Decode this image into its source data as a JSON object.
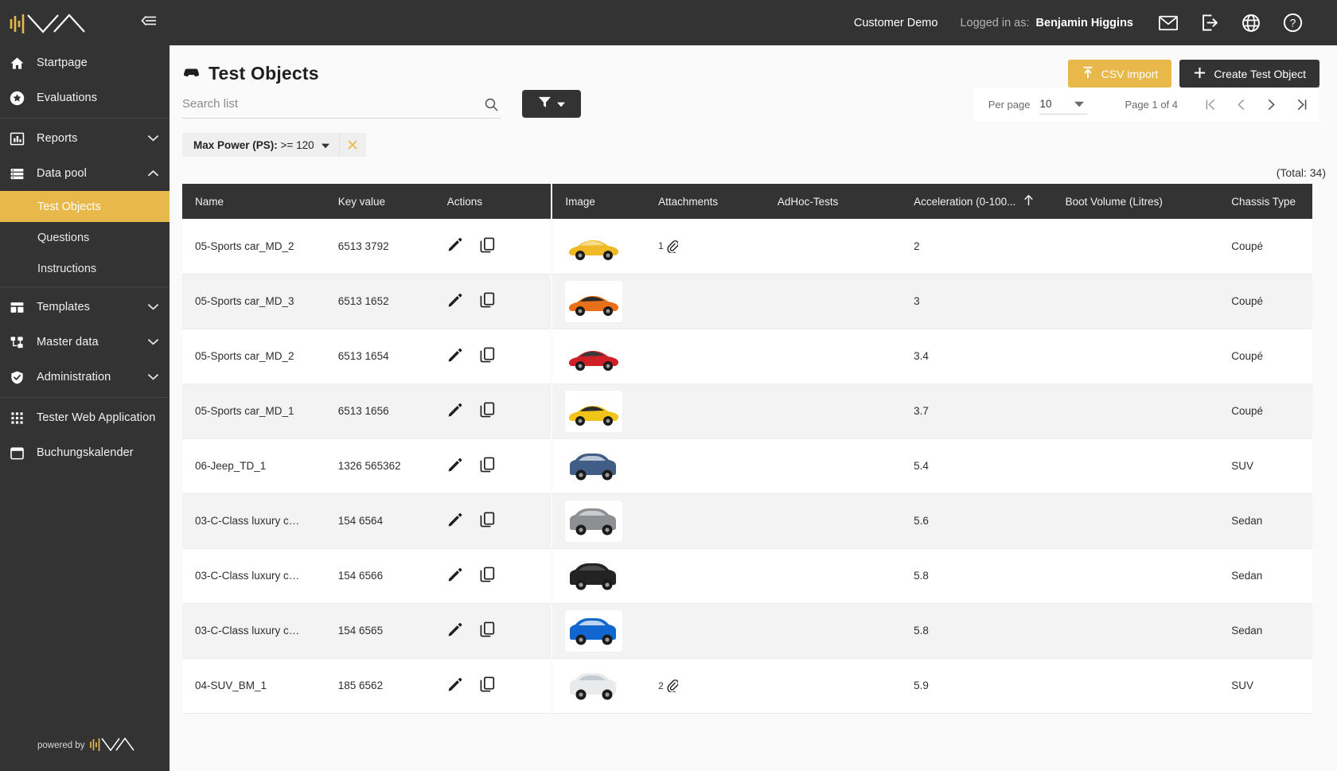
{
  "sidebar": {
    "logo_alt": "brand-logo",
    "collapse_icon": "collapse-sidebar-icon",
    "items": [
      {
        "label": "Startpage",
        "icon": "home-icon",
        "expandable": false,
        "expanded": false
      },
      {
        "label": "Evaluations",
        "icon": "star-icon",
        "expandable": false,
        "expanded": false
      },
      {
        "label": "Reports",
        "icon": "bar-chart-icon",
        "expandable": true,
        "expanded": false
      },
      {
        "label": "Data pool",
        "icon": "list-icon",
        "expandable": true,
        "expanded": true
      },
      {
        "label": "Templates",
        "icon": "layout-icon",
        "expandable": true,
        "expanded": false
      },
      {
        "label": "Master data",
        "icon": "hierarchy-icon",
        "expandable": true,
        "expanded": false
      },
      {
        "label": "Administration",
        "icon": "shield-check-icon",
        "expandable": true,
        "expanded": false
      },
      {
        "label": "Tester Web Application",
        "icon": "grid-apps-icon",
        "expandable": false,
        "expanded": false
      },
      {
        "label": "Buchungskalender",
        "icon": "calendar-icon",
        "expandable": false,
        "expanded": false
      }
    ],
    "sub_items": [
      {
        "label": "Test Objects",
        "active": true
      },
      {
        "label": "Questions",
        "active": false
      },
      {
        "label": "Instructions",
        "active": false
      }
    ],
    "powered_by": "powered by"
  },
  "topbar": {
    "customer": "Customer Demo",
    "logged_in_label": "Logged in as:",
    "user_name": "Benjamin Higgins",
    "icons": [
      "mail-icon",
      "logout-icon",
      "globe-icon",
      "help-icon"
    ]
  },
  "page": {
    "title": "Test Objects",
    "title_icon": "car-icon",
    "csv_import_label": "CSV import",
    "csv_import_icon": "upload-icon",
    "create_label": "Create Test Object",
    "create_icon": "plus-icon",
    "total_label": "(Total: 34)"
  },
  "search": {
    "placeholder": "Search list",
    "value": "",
    "icon": "search-icon"
  },
  "filter": {
    "button_icon": "funnel-icon",
    "caret_icon": "caret-down-icon",
    "chip_label": "Max Power (PS):",
    "chip_value": ">= 120",
    "chip_caret_icon": "caret-down-icon",
    "chip_remove_icon": "close-icon"
  },
  "pagination": {
    "per_page_label": "Per page",
    "per_page_value": "10",
    "per_page_caret": "caret-down-icon",
    "page_info": "Page 1 of 4",
    "first_icon": "first-page-icon",
    "prev_icon": "prev-page-icon",
    "next_icon": "next-page-icon",
    "last_icon": "last-page-icon"
  },
  "table": {
    "columns": [
      {
        "key": "name",
        "label": "Name"
      },
      {
        "key": "keyval",
        "label": "Key value"
      },
      {
        "key": "actions",
        "label": "Actions"
      },
      {
        "key": "image",
        "label": "Image"
      },
      {
        "key": "attach",
        "label": "Attachments"
      },
      {
        "key": "adhoc",
        "label": "AdHoc-Tests"
      },
      {
        "key": "accel",
        "label": "Acceleration (0-100...",
        "sorted": true,
        "sort_icon": "sort-asc-icon"
      },
      {
        "key": "boot",
        "label": "Boot Volume (Litres)"
      },
      {
        "key": "chassis",
        "label": "Chassis Type"
      }
    ],
    "row_actions": [
      {
        "name": "edit-icon"
      },
      {
        "name": "copy-icon"
      }
    ],
    "rows": [
      {
        "name": "05-Sports car_MD_2",
        "keyval": "6513 3792",
        "attach": "1",
        "adhoc": "",
        "accel": "2",
        "boot": "",
        "chassis": "Coupé",
        "car": "sports-yellow"
      },
      {
        "name": "05-Sports car_MD_3",
        "keyval": "6513 1652",
        "attach": "",
        "adhoc": "",
        "accel": "3",
        "boot": "",
        "chassis": "Coupé",
        "car": "sports-orange"
      },
      {
        "name": "05-Sports car_MD_2",
        "keyval": "6513 1654",
        "attach": "",
        "adhoc": "",
        "accel": "3.4",
        "boot": "",
        "chassis": "Coupé",
        "car": "sports-red"
      },
      {
        "name": "05-Sports car_MD_1",
        "keyval": "6513 1656",
        "attach": "",
        "adhoc": "",
        "accel": "3.7",
        "boot": "",
        "chassis": "Coupé",
        "car": "muscle-yellow"
      },
      {
        "name": "06-Jeep_TD_1",
        "keyval": "1326 565362",
        "attach": "",
        "adhoc": "",
        "accel": "5.4",
        "boot": "",
        "chassis": "SUV",
        "car": "suv-blue"
      },
      {
        "name": "03-C-Class luxury c…",
        "keyval": "154 6564",
        "attach": "",
        "adhoc": "",
        "accel": "5.6",
        "boot": "",
        "chassis": "Sedan",
        "car": "sedan-silver"
      },
      {
        "name": "03-C-Class luxury c…",
        "keyval": "154 6566",
        "attach": "",
        "adhoc": "",
        "accel": "5.8",
        "boot": "",
        "chassis": "Sedan",
        "car": "sedan-black"
      },
      {
        "name": "03-C-Class luxury c…",
        "keyval": "154 6565",
        "attach": "",
        "adhoc": "",
        "accel": "5.8",
        "boot": "",
        "chassis": "Sedan",
        "car": "sedan-blue"
      },
      {
        "name": "04-SUV_BM_1",
        "keyval": "185 6562",
        "attach": "2",
        "adhoc": "",
        "accel": "5.9",
        "boot": "",
        "chassis": "SUV",
        "car": "suv-white"
      }
    ]
  },
  "colors": {
    "accent": "#e8b84b",
    "dark": "#333333",
    "page_bg": "#fafafa",
    "row_alt": "#f3f3f3"
  }
}
